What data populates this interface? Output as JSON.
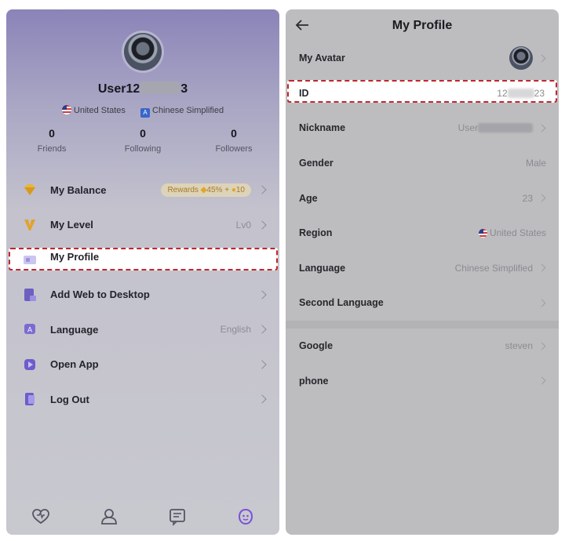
{
  "left": {
    "profile": {
      "username_start": "User12",
      "username_end": "3",
      "country": "United States",
      "language": "Chinese Simplified",
      "stats": [
        {
          "value": "0",
          "label": "Friends"
        },
        {
          "value": "0",
          "label": "Following"
        },
        {
          "value": "0",
          "label": "Followers"
        }
      ]
    },
    "menu": {
      "balance": {
        "label": "My Balance",
        "rewards_prefix": "Rewards",
        "rewards_pct": "45%",
        "rewards_plus": "+",
        "rewards_num": "10"
      },
      "level": {
        "label": "My Level",
        "value": "Lv0"
      },
      "profile": {
        "label": "My Profile"
      },
      "add_web": {
        "label": "Add Web to Desktop"
      },
      "language": {
        "label": "Language",
        "value": "English"
      },
      "open_app": {
        "label": "Open App"
      },
      "logout": {
        "label": "Log Out"
      }
    },
    "accent": "#8b5cf6"
  },
  "right": {
    "title": "My Profile",
    "rows": {
      "avatar": {
        "label": "My Avatar"
      },
      "id": {
        "label": "ID",
        "value_start": "12",
        "value_end": "23"
      },
      "nickname": {
        "label": "Nickname",
        "value_start": "User"
      },
      "gender": {
        "label": "Gender",
        "value": "Male"
      },
      "age": {
        "label": "Age",
        "value": "23"
      },
      "region": {
        "label": "Region",
        "value": "United States"
      },
      "language": {
        "label": "Language",
        "value": "Chinese Simplified"
      },
      "second_language": {
        "label": "Second Language"
      },
      "google": {
        "label": "Google",
        "value": "steven"
      },
      "phone": {
        "label": "phone"
      }
    }
  },
  "highlight_color": "#c0262e"
}
